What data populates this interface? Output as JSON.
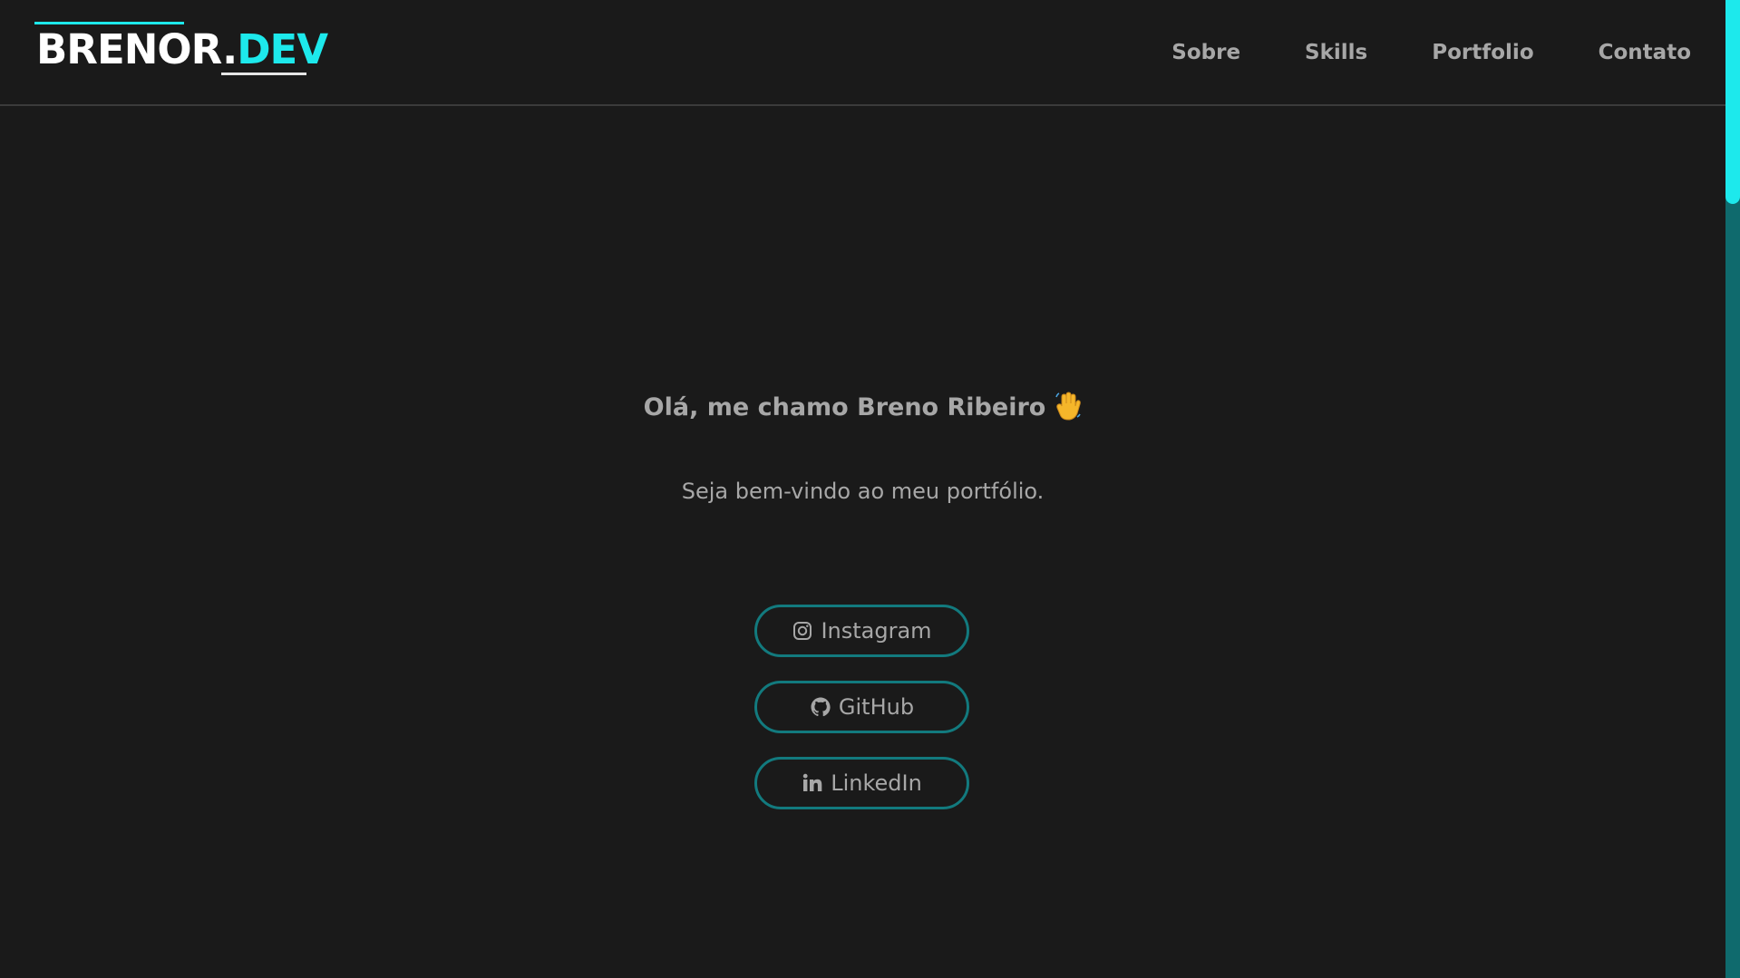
{
  "header": {
    "logo_main": "BRENOR.",
    "logo_accent": "DEV",
    "nav": [
      {
        "label": "Sobre"
      },
      {
        "label": "Skills"
      },
      {
        "label": "Portfolio"
      },
      {
        "label": "Contato"
      }
    ]
  },
  "hero": {
    "title": "Olá, me chamo Breno Ribeiro",
    "subtitle": "Seja bem-vindo ao meu portfólio."
  },
  "social": [
    {
      "label": "Instagram",
      "icon": "instagram-icon"
    },
    {
      "label": "GitHub",
      "icon": "github-icon"
    },
    {
      "label": "LinkedIn",
      "icon": "linkedin-icon"
    }
  ],
  "colors": {
    "background": "#1a1a1a",
    "accent": "#1de9ec",
    "button_border": "#127a7e",
    "text_muted": "#a7a7a7",
    "scroll_track": "#0f6a6d"
  }
}
